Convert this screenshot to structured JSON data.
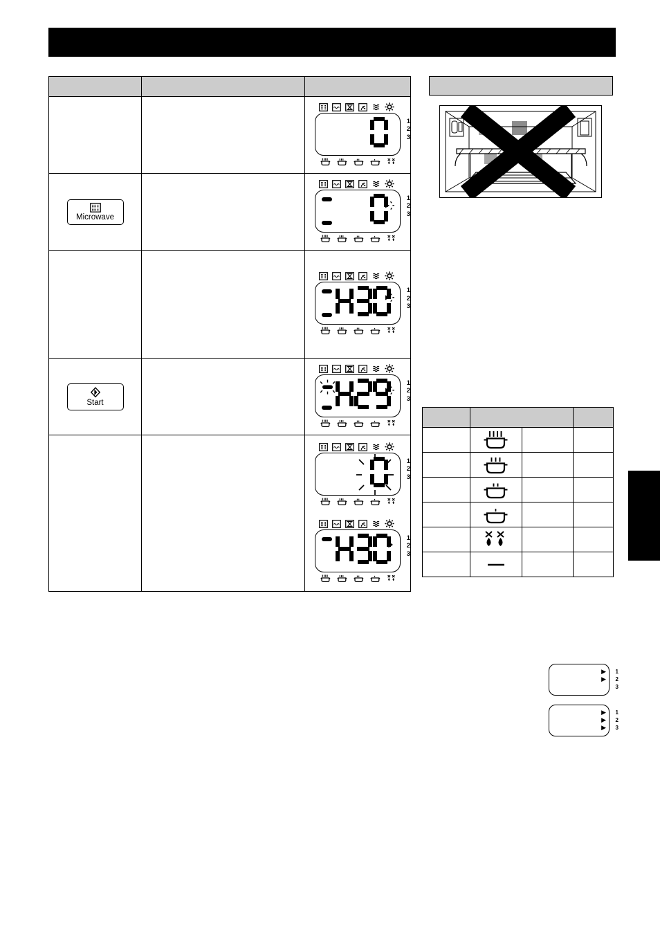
{
  "page": {
    "title_bar_text": "",
    "index_tab_text": ""
  },
  "procedure_table": {
    "headers": [
      "",
      "",
      ""
    ],
    "rows": [
      {
        "operation_label": "",
        "operation_icon": "",
        "description": "",
        "display": {
          "digits": "0",
          "level_labels": [
            "1",
            "2",
            "3"
          ],
          "top_icons": [
            "microwave-icon",
            "oven-icon",
            "grill-icon",
            "convection-fan-icon",
            "heat-waves-icon",
            "light-icon"
          ],
          "bottom_icons": [
            "steam-level-4-icon",
            "steam-level-3-icon",
            "steam-level-2-icon",
            "steam-level-1-icon",
            "defrost-icon"
          ],
          "top_left_bar": false,
          "bottom_left_bar": false,
          "flashing": "none",
          "arrow": "none"
        }
      },
      {
        "operation_label": "Microwave",
        "operation_icon": "microwave-icon",
        "description": "",
        "display": {
          "digits": "0",
          "level_labels": [
            "1",
            "2",
            "3"
          ],
          "top_icons": [
            "microwave-icon",
            "oven-icon",
            "grill-icon",
            "convection-fan-icon",
            "heat-waves-icon",
            "light-icon"
          ],
          "bottom_icons": [
            "steam-level-4-icon",
            "steam-level-3-icon",
            "steam-level-2-icon",
            "steam-level-1-icon",
            "defrost-icon"
          ],
          "top_left_bar": true,
          "bottom_left_bar": true,
          "flashing": "arrow",
          "arrow": "flashing-right-arrow"
        }
      },
      {
        "operation_label": "",
        "operation_icon": "",
        "description": "",
        "display": {
          "digits": "430",
          "level_labels": [
            "1",
            "2",
            "3"
          ],
          "top_icons": [
            "microwave-icon",
            "oven-icon",
            "grill-icon",
            "convection-fan-icon",
            "heat-waves-icon",
            "light-icon"
          ],
          "bottom_icons": [
            "steam-level-4-icon",
            "steam-level-3-icon",
            "steam-level-2-icon",
            "steam-level-1-icon",
            "defrost-icon"
          ],
          "top_left_bar": true,
          "bottom_left_bar": true,
          "flashing": "arrow",
          "arrow": "flashing-right-arrow"
        }
      },
      {
        "operation_label": "Start",
        "operation_icon": "start-diamond-icon",
        "description": "",
        "display": {
          "digits": "429",
          "level_labels": [
            "1",
            "2",
            "3"
          ],
          "top_icons": [
            "microwave-icon",
            "oven-icon",
            "grill-icon",
            "convection-fan-icon",
            "heat-waves-icon",
            "light-icon"
          ],
          "bottom_icons": [
            "steam-level-4-icon",
            "steam-level-3-icon",
            "steam-level-2-icon",
            "steam-level-1-icon",
            "defrost-icon"
          ],
          "top_left_bar": false,
          "bottom_left_bar": true,
          "flashing": "top-left-bar",
          "arrow": "flashing-right-arrow"
        }
      },
      {
        "operation_label": "",
        "operation_icon": "",
        "description": "",
        "display": {
          "digits": "0",
          "level_labels": [
            "1",
            "2",
            "3"
          ],
          "top_icons": [
            "microwave-icon",
            "oven-icon",
            "grill-icon",
            "convection-fan-icon",
            "heat-waves-icon",
            "light-icon"
          ],
          "bottom_icons": [
            "steam-level-4-icon",
            "steam-level-3-icon",
            "steam-level-2-icon",
            "steam-level-1-icon",
            "defrost-icon"
          ],
          "top_left_bar": false,
          "bottom_left_bar": false,
          "flashing": "digit",
          "arrow": "none"
        },
        "display2": {
          "digits": "430",
          "level_labels": [
            "1",
            "2",
            "3"
          ],
          "top_icons": [
            "microwave-icon",
            "oven-icon",
            "grill-icon",
            "convection-fan-icon",
            "heat-waves-icon",
            "light-icon"
          ],
          "bottom_icons": [
            "steam-level-4-icon",
            "steam-level-3-icon",
            "steam-level-2-icon",
            "steam-level-1-icon",
            "defrost-icon"
          ],
          "top_left_bar": true,
          "bottom_left_bar": false,
          "flashing": "none",
          "arrow": "solid-right-arrow"
        }
      }
    ]
  },
  "warning_panel": {
    "heading": "",
    "figure_name": "oven-interior-with-rack-crossed-out",
    "prohibition_mark": "big-black-x"
  },
  "power_table": {
    "headers": [
      "",
      "",
      ""
    ],
    "rows": [
      {
        "col1": "",
        "icon": "steam-pot-4-lines-icon",
        "col3": "",
        "col4": ""
      },
      {
        "col1": "",
        "icon": "steam-pot-3-lines-icon",
        "col3": "",
        "col4": ""
      },
      {
        "col1": "",
        "icon": "steam-pot-2-lines-icon",
        "col3": "",
        "col4": ""
      },
      {
        "col1": "",
        "icon": "steam-pot-1-line-icon",
        "col3": "",
        "col4": ""
      },
      {
        "col1": "",
        "icon": "defrost-snow-drops-icon",
        "col3": "",
        "col4": ""
      },
      {
        "col1": "",
        "icon": "dash-icon",
        "col3": "",
        "col4": ""
      }
    ]
  },
  "mini_displays": [
    {
      "name": "level-indicator-1-2",
      "level_labels": [
        "1",
        "2",
        "3"
      ],
      "arrows": [
        true,
        true,
        false
      ]
    },
    {
      "name": "level-indicator-1-2-3",
      "level_labels": [
        "1",
        "2",
        "3"
      ],
      "arrows": [
        true,
        true,
        true
      ]
    }
  ],
  "colors": {
    "header_fill": "#cccccc",
    "bar_fill": "#000000",
    "page_background": "#ffffff"
  }
}
